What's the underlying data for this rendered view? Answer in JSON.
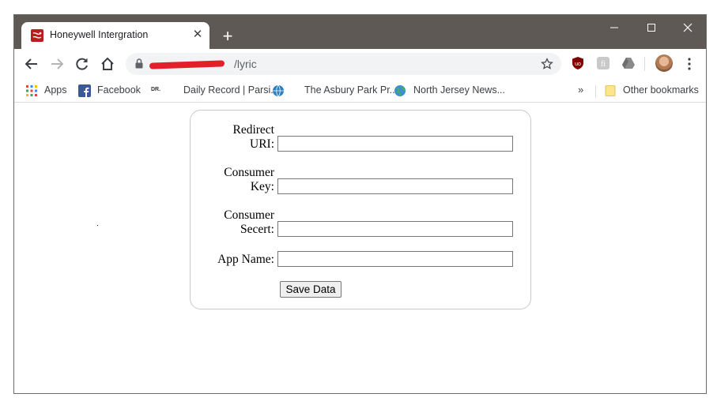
{
  "browser": {
    "tab": {
      "title": "Honeywell Intergration",
      "close_glyph": "✕"
    },
    "new_tab_glyph": "+",
    "window_controls": {
      "minimize": "—",
      "close": "✕"
    },
    "address_bar": {
      "url_visible_suffix": "/lyric"
    },
    "bookmarks": [
      {
        "label": "Apps",
        "icon": "apps-grid-icon"
      },
      {
        "label": "Facebook",
        "icon": "facebook-icon"
      },
      {
        "label": "Daily Record | Parsi...",
        "icon": "dr-icon",
        "icon_text": "DR."
      },
      {
        "label": "The Asbury Park Pr...",
        "icon": "globe-icon"
      },
      {
        "label": "North Jersey News...",
        "icon": "globe-icon"
      }
    ],
    "bookmarks_overflow": "»",
    "other_bookmarks": "Other bookmarks",
    "colors": {
      "titlebar": "#5e5955",
      "redaction": "#e3202a",
      "favicon": "#b91d1d"
    }
  },
  "form": {
    "redirect_uri_label_line1": "Redirect",
    "redirect_uri_label_line2": "URI:",
    "consumer_key_label_line1": "Consumer",
    "consumer_key_label_line2": "Key:",
    "consumer_secret_label_line1": "Consumer",
    "consumer_secret_label_line2": "Secert:",
    "app_name_label": "App Name:",
    "save_button": "Save Data"
  }
}
